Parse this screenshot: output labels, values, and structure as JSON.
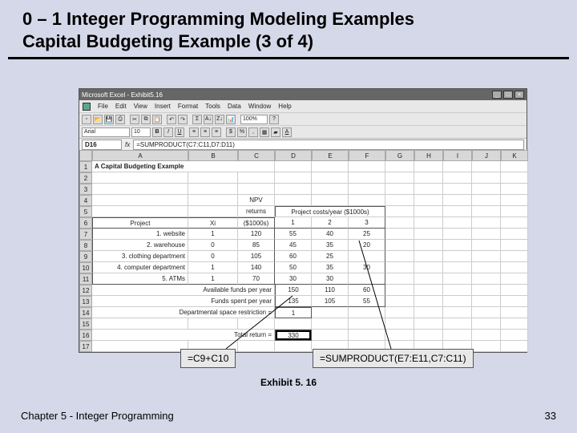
{
  "slide": {
    "title_line1": "0 – 1 Integer Programming Modeling Examples",
    "title_line2": "Capital Budgeting Example (3 of 4)",
    "exhibit": "Exhibit 5. 16",
    "footer_left": "Chapter 5 - Integer Programming",
    "page_number": "33"
  },
  "excel": {
    "app_title": "Microsoft Excel - Exhibit5.16",
    "menu": [
      "File",
      "Edit",
      "View",
      "Insert",
      "Format",
      "Tools",
      "Data",
      "Window",
      "Help"
    ],
    "font": "Arial",
    "font_size": "10",
    "zoom": "100%",
    "name_box": "D16",
    "formula_bar": "=SUMPRODUCT(C7:C11,D7:D11)",
    "columns": [
      "A",
      "B",
      "C",
      "D",
      "E",
      "F",
      "G",
      "H",
      "I",
      "J",
      "K"
    ],
    "sheet": {
      "r1": {
        "a": "A Capital Budgeting Example"
      },
      "r4": {
        "c": "NPV"
      },
      "r5": {
        "c": "returns",
        "d_span": "Project costs/year ($1000s)"
      },
      "r6": {
        "a": "Project",
        "b": "Xi",
        "c": "($1000s)",
        "d": "1",
        "e": "2",
        "f": "3"
      },
      "r7": {
        "a": "1. website",
        "b": "1",
        "c": "120",
        "d": "55",
        "e": "40",
        "f": "25"
      },
      "r8": {
        "a": "2. warehouse",
        "b": "0",
        "c": "85",
        "d": "45",
        "e": "35",
        "f": "20"
      },
      "r9": {
        "a": "3. clothing department",
        "b": "0",
        "c": "105",
        "d": "60",
        "e": "25"
      },
      "r10": {
        "a": "4. computer department",
        "b": "1",
        "c": "140",
        "d": "50",
        "e": "35",
        "f": "30"
      },
      "r11": {
        "a": "5. ATMs",
        "b": "1",
        "c": "70",
        "d": "30",
        "e": "30"
      },
      "r12": {
        "a": "Available funds per year",
        "d": "150",
        "e": "110",
        "f": "60"
      },
      "r13": {
        "a": "Funds spent per year",
        "d": "135",
        "e": "105",
        "f": "55"
      },
      "r14": {
        "a": "Departmental space restriction =",
        "d": "1"
      },
      "r16": {
        "a": "Total return =",
        "d": "330"
      }
    }
  },
  "callouts": {
    "left": "=C9+C10",
    "right": "=SUMPRODUCT(E7:E11,C7:C11)"
  },
  "chart_data": {
    "type": "table",
    "title": "A Capital Budgeting Example",
    "projects": [
      {
        "name": "1. website",
        "xi": 1,
        "npv": 120,
        "costs": [
          55,
          40,
          25
        ]
      },
      {
        "name": "2. warehouse",
        "xi": 0,
        "npv": 85,
        "costs": [
          45,
          35,
          20
        ]
      },
      {
        "name": "3. clothing department",
        "xi": 0,
        "npv": 105,
        "costs": [
          60,
          25,
          null
        ]
      },
      {
        "name": "4. computer department",
        "xi": 1,
        "npv": 140,
        "costs": [
          50,
          35,
          30
        ]
      },
      {
        "name": "5. ATMs",
        "xi": 1,
        "npv": 70,
        "costs": [
          30,
          30,
          null
        ]
      }
    ],
    "available_funds": [
      150,
      110,
      60
    ],
    "funds_spent": [
      135,
      105,
      55
    ],
    "departmental_space_restriction": 1,
    "total_return": 330
  }
}
